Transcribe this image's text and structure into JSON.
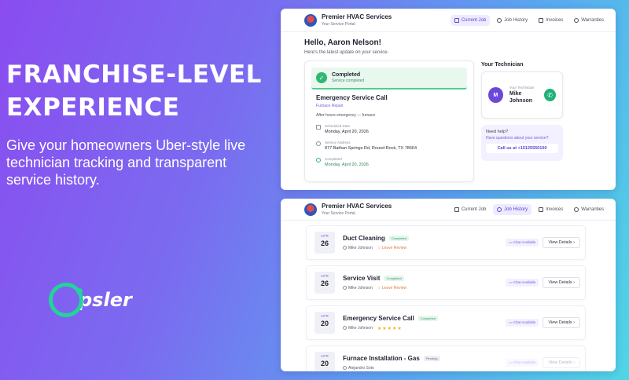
{
  "hero": {
    "headline_1": "FRANCHISE-LEVEL",
    "headline_2": "EXPERIENCE",
    "body": "Give your homeowners Uber-style live technician tracking and transparent service history."
  },
  "logo": {
    "text": "psler"
  },
  "portal": {
    "brand_name": "Premier HVAC Services",
    "brand_sub": "Your Service Portal",
    "tabs": [
      {
        "label": "Current Job",
        "icon": "clipboard-icon"
      },
      {
        "label": "Job History",
        "icon": "history-icon"
      },
      {
        "label": "Invoices",
        "icon": "document-icon"
      },
      {
        "label": "Warranties",
        "icon": "shield-icon"
      }
    ]
  },
  "current": {
    "greeting": "Hello, Aaron Nelson!",
    "subtitle": "Here's the latest update on your service.",
    "status_title": "Completed",
    "status_sub": "Service completed",
    "service_title": "Emergency Service Call",
    "category": "Furnace Repair",
    "description": "After-hours emergency — furnace",
    "scheduled_label": "Scheduled Date",
    "scheduled_value": "Monday, April 20, 2026",
    "address_label": "Service Address",
    "address_value": "877 Bathan Springs Rd, Round Rock, TX 78664",
    "completed_label": "Completed",
    "completed_value": "Monday, April 20, 2026",
    "tech_section": "Your Technician",
    "tech_initial": "M",
    "tech_role": "Your Technician",
    "tech_name": "Mike Johnson",
    "help_title": "Need help?",
    "help_sub": "Have questions about your service?",
    "call_label": "Call us at +15125550100"
  },
  "jobs": [
    {
      "month": "APR",
      "day": "26",
      "title": "Duct Cleaning",
      "status": "Completed",
      "tech": "Mike Johnson",
      "review": "Leave Review",
      "stars": "",
      "chat": "Chat Available",
      "details": "View Details"
    },
    {
      "month": "APR",
      "day": "26",
      "title": "Service Visit",
      "status": "Completed",
      "tech": "Mike Johnson",
      "review": "Leave Review",
      "stars": "",
      "chat": "Chat Available",
      "details": "View Details"
    },
    {
      "month": "APR",
      "day": "20",
      "title": "Emergency Service Call",
      "status": "Completed",
      "tech": "Mike Johnson",
      "review": "",
      "stars": "★★★★★",
      "chat": "Chat Available",
      "details": "View Details"
    },
    {
      "month": "APR",
      "day": "20",
      "title": "Furnace Installation - Gas",
      "status": "Pending",
      "tech": "Alejandro Soto",
      "review": "",
      "stars": "",
      "chat": "Chat Available",
      "details": "View Details"
    }
  ],
  "colors": {
    "accent": "#5b45d6",
    "success": "#2fb872",
    "review": "#e0823a",
    "star": "#f2b21b"
  }
}
